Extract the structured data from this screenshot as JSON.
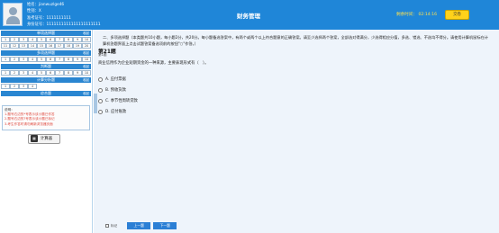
{
  "header": {
    "name_label": "姓名：jianwuzlge46",
    "id_label": "性别：X",
    "exam_id_label": "准考证号：1111111111",
    "cert_label": "身份证号：1111111111111111111111",
    "title": "财务管理",
    "timer_label": "剩余时间：",
    "timer_value": "02:14:16",
    "submit_label": "交卷"
  },
  "sidebar": {
    "sections": [
      {
        "title": "单项选择题",
        "collapse": "收起",
        "items": [
          "1",
          "2",
          "3",
          "4",
          "5",
          "6",
          "7",
          "8",
          "9",
          "10",
          "11",
          "12",
          "13",
          "14",
          "15",
          "16",
          "17",
          "18",
          "19",
          "20"
        ]
      },
      {
        "title": "多项选择题",
        "collapse": "收起",
        "items": [
          "1",
          "2",
          "3",
          "4",
          "5",
          "6",
          "7",
          "8",
          "9",
          "10"
        ]
      },
      {
        "title": "判断题",
        "collapse": "收起",
        "items": [
          "1",
          "2",
          "3",
          "4",
          "5",
          "6",
          "7",
          "8",
          "9",
          "10"
        ]
      },
      {
        "title": "计算分析题",
        "collapse": "收起",
        "items": [
          "1",
          "2",
          "3",
          "4"
        ]
      },
      {
        "title": "综合题",
        "collapse": "收起",
        "items": []
      }
    ],
    "notes": {
      "title": "说明：",
      "lines": [
        "1.题号右边的*号表示该小题已作答",
        "2.题号右边的?号表示该小题已标记",
        "3.考生作答时请勿刷新浏览器页面"
      ]
    },
    "calculator_label": "计算器"
  },
  "main": {
    "description": "二、多项选择题（本类题共10小题，每小题2分，共20分。每小题备选答案中，有两个或两个以上符合题意的正确答案。请至少选择两个答案，全部选对得满分，少选得相应分值，多选、错选、不选均不得分。请使用计算机鼠标在计算机答题界面上点击试题答案备选项前的按钮\"○\"作答。）",
    "question_number": "第21题",
    "question_score": "第1题",
    "stem": "商业信用作为企业短期资金的一种来源，主要表现形式有（　）。",
    "options": [
      {
        "key": "A",
        "text": "A. 应付票据"
      },
      {
        "key": "B",
        "text": "B. 预收货款"
      },
      {
        "key": "C",
        "text": "C. 季节性周转贷款"
      },
      {
        "key": "D",
        "text": "D. 应付账款"
      }
    ],
    "mark_label": "标记",
    "prev_label": "上一题",
    "next_label": "下一题"
  }
}
